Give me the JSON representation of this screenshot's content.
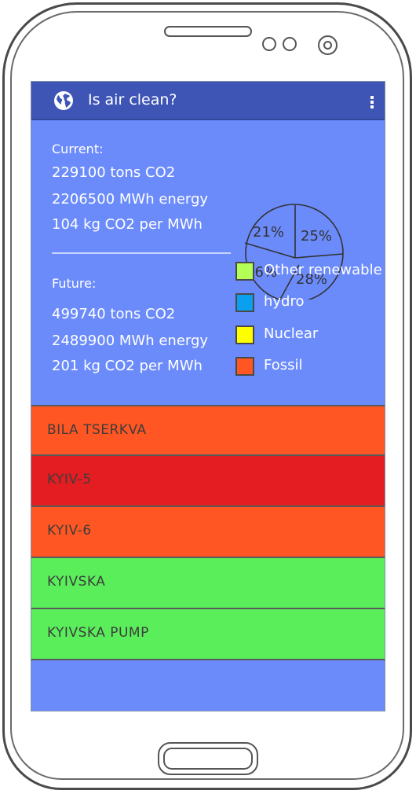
{
  "app": {
    "title": "Is air clean?"
  },
  "current": {
    "heading": "Current:",
    "co2": "229100 tons CO2",
    "energy": "2206500 MWh energy",
    "intensity": "104 kg CO2 per MWh"
  },
  "future": {
    "heading": "Future:",
    "co2": "499740 tons CO2",
    "energy": "2489900 MWh energy",
    "intensity": "201 kg CO2 per MWh"
  },
  "pie": {
    "labels": [
      "21%",
      "25%",
      "26%",
      "28%"
    ]
  },
  "legend": [
    {
      "label": "Other renewable",
      "color": "#b3ff55"
    },
    {
      "label": "hydro",
      "color": "#0aa0ef"
    },
    {
      "label": "Nuclear",
      "color": "#ffff00"
    },
    {
      "label": "Fossil",
      "color": "#ff5623"
    }
  ],
  "stations": [
    {
      "name": "BILA TSERKVA",
      "color": "#ff5623"
    },
    {
      "name": "KYIV-5",
      "color": "#e31d21"
    },
    {
      "name": "KYIV-6",
      "color": "#ff5623"
    },
    {
      "name": "KYIVSKA",
      "color": "#5aef5a"
    },
    {
      "name": "KYIVSKA PUMP",
      "color": "#5aef5a"
    }
  ]
}
